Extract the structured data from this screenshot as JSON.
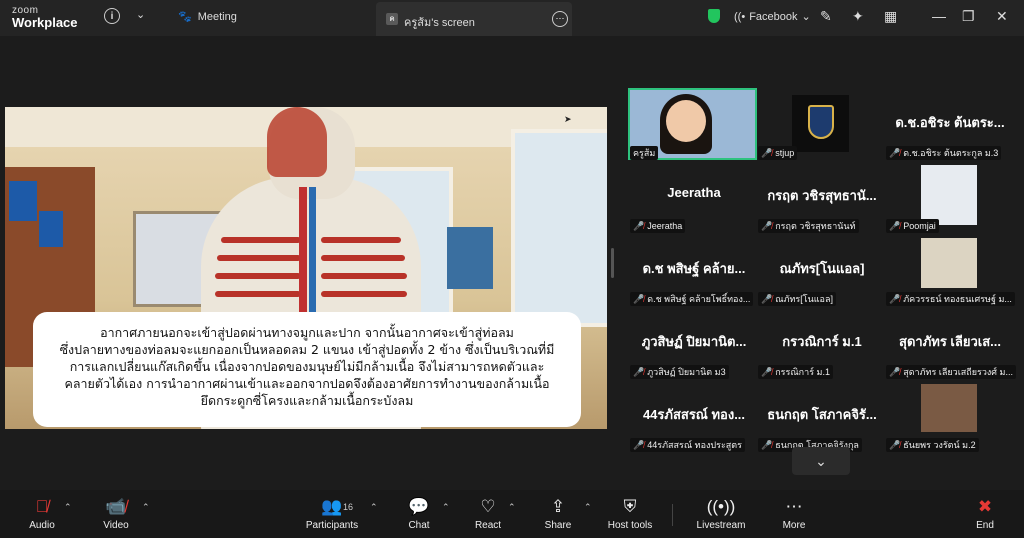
{
  "app": {
    "logo_top": "zoom",
    "logo_bottom": "Workplace"
  },
  "topbar": {
    "meeting_label": "Meeting",
    "screen_tab_label": "ครูส้ม's screen",
    "screen_tab_avatar": "ค",
    "facebook_label": "Facebook"
  },
  "caption_lines": [
    "อากาศภายนอกจะเข้าสู่ปอดผ่านทางจมูกและปาก จากนั้นอากาศจะเข้าสู่ท่อลม",
    "ซึ่งปลายทางของท่อลมจะแยกออกเป็นหลอดลม 2 แขนง เข้าสู่ปอดทั้ง 2 ข้าง ซึ่งเป็นบริเวณที่มี",
    "การแลกเปลี่ยนแก๊สเกิดขึ้น เนื่องจากปอดของมนุษย์ไม่มีกล้ามเนื้อ จึงไม่สามารถหดตัวและ",
    "คลายตัวได้เอง การนำอากาศผ่านเข้าและออกจากปอดจึงต้องอาศัยการทำงานของกล้ามเนื้อ",
    "ยึดกระดูกซี่โครงและกล้ามเนื้อกระบังลม"
  ],
  "participants": [
    {
      "label": "ครูส้ม"
    },
    {
      "label": "stjup"
    },
    {
      "big": "ด.ช.อชิระ ต้นตระ...",
      "label": "ด.ช.อชิระ ต้นตระกูล ม.3"
    },
    {
      "big": "Jeeratha",
      "label": "Jeeratha"
    },
    {
      "big": "กรฤต วชิรสุทธานั...",
      "label": "กรฤต วชิรสุทธานันท์"
    },
    {
      "label": "Poomjai"
    },
    {
      "big": "ด.ช พสิษฐ์ คล้าย...",
      "label": "ด.ช พสิษฐ์ คล้ายโพธิ์ทอง..."
    },
    {
      "big": "ณภัทร[โนแอล]",
      "label": "ณภัทร[โนแอล]"
    },
    {
      "label": "ภัควรรธน์ ทองธนเศรษฐ์ ม..."
    },
    {
      "big": "ภูวสิษฏ์ ปิยมานิต...",
      "label": "ภูวสิษฏ์ ปิยมานิต ม3"
    },
    {
      "big": "กรวณิการ์ ม.1",
      "label": "กรรณิการ์ ม.1"
    },
    {
      "big": "สุดาภัทร เลียวเส...",
      "label": "สุดาภัทร เลียวเสถียรวงศ์ ม..."
    },
    {
      "big": "44รภัสสรณ์ ทอง...",
      "label": "44รภัสสรณ์ ทองประสูตร"
    },
    {
      "big": "ธนกฤต โสภาคจิรั...",
      "label": "ธนกฤต โสภาคจิรังกุล"
    },
    {
      "label": "ธันยพร วงรัตน์ ม.2"
    }
  ],
  "toolbar": {
    "audio": "Audio",
    "video": "Video",
    "participants": "Participants",
    "participants_count": "16",
    "chat": "Chat",
    "react": "React",
    "share": "Share",
    "host_tools": "Host tools",
    "livestream": "Livestream",
    "more": "More",
    "end": "End"
  },
  "colors": {
    "accent_green": "#2ec27e",
    "end_red": "#e53935",
    "muted_red": "#e53935"
  }
}
